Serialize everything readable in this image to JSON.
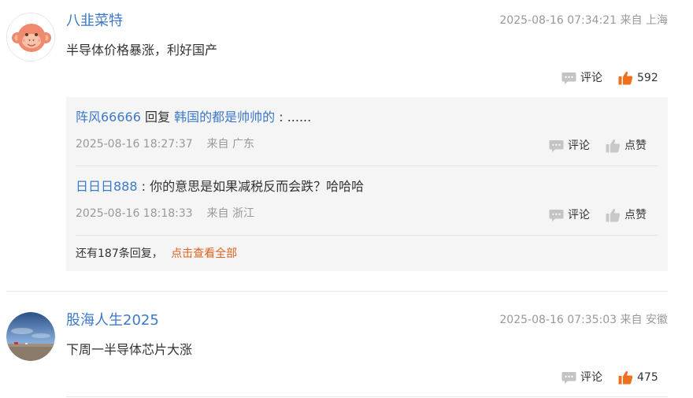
{
  "comments": [
    {
      "username": "八韭菜特",
      "timestamp": "2025-08-16 07:34:21",
      "location": "来自 上海",
      "content": "半导体价格暴涨，利好国产",
      "comment_label": "评论",
      "likes": "592",
      "replies": [
        {
          "user": "阵风66666",
          "reply_word": "回复",
          "target": "韩国的都是帅帅的",
          "text": " : ......",
          "timestamp": "2025-08-16 18:27:37",
          "location": "来自 广东",
          "comment_label": "评论",
          "like_label": "点赞"
        },
        {
          "user": "日日日888",
          "text": " : 你的意思是如果减税反而会跌？哈哈哈",
          "timestamp": "2025-08-16 18:18:33",
          "location": "来自 浙江",
          "comment_label": "评论",
          "like_label": "点赞"
        }
      ],
      "more_text": "还有187条回复，",
      "more_link": "点击查看全部"
    },
    {
      "username": "股海人生2025",
      "timestamp": "2025-08-16 07:35:03",
      "location": "来自 安徽",
      "content": "下周一半导体芯片大涨",
      "comment_label": "评论",
      "likes": "475"
    }
  ],
  "colors": {
    "username": "#3c79c8",
    "like_active": "#f0701e",
    "more_link": "#e0611f",
    "reply_bg": "#f5f5f5"
  },
  "icons": {
    "comment": "speech-bubble-icon",
    "like": "thumbs-up-icon"
  }
}
